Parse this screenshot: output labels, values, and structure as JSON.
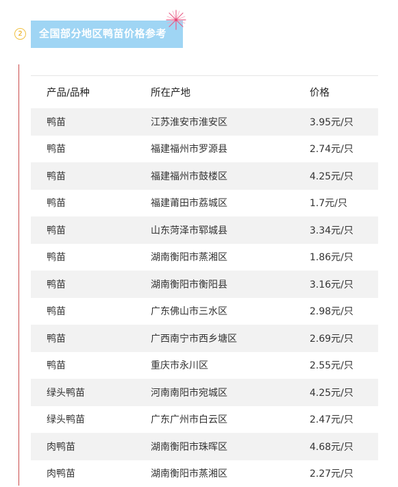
{
  "section": {
    "number": "2",
    "title": "全国部分地区鸭苗价格参考"
  },
  "table": {
    "headers": [
      "产品/品种",
      "所在产地",
      "价格"
    ],
    "rows": [
      [
        "鸭苗",
        "江苏淮安市淮安区",
        "3.95元/只"
      ],
      [
        "鸭苗",
        "福建福州市罗源县",
        "2.74元/只"
      ],
      [
        "鸭苗",
        "福建福州市鼓楼区",
        "4.25元/只"
      ],
      [
        "鸭苗",
        "福建莆田市荔城区",
        "1.7元/只"
      ],
      [
        "鸭苗",
        "山东菏泽市郓城县",
        "3.34元/只"
      ],
      [
        "鸭苗",
        "湖南衡阳市蒸湘区",
        "1.86元/只"
      ],
      [
        "鸭苗",
        "湖南衡阳市衡阳县",
        "3.16元/只"
      ],
      [
        "鸭苗",
        "广东佛山市三水区",
        "2.98元/只"
      ],
      [
        "鸭苗",
        "广西南宁市西乡塘区",
        "2.69元/只"
      ],
      [
        "鸭苗",
        "重庆市永川区",
        "2.55元/只"
      ],
      [
        "绿头鸭苗",
        "河南南阳市宛城区",
        "4.25元/只"
      ],
      [
        "绿头鸭苗",
        "广东广州市白云区",
        "2.47元/只"
      ],
      [
        "肉鸭苗",
        "湖南衡阳市珠晖区",
        "4.68元/只"
      ],
      [
        "肉鸭苗",
        "湖南衡阳市蒸湘区",
        "2.27元/只"
      ]
    ]
  },
  "colors": {
    "title_bg": "#9fd5f4",
    "badge": "#e8a400",
    "accent_line": "#c94a4a",
    "row_alt": "#f2f2f2"
  }
}
